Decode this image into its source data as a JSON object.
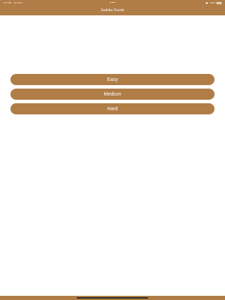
{
  "status_bar": {
    "time": "1:57 PM",
    "date": "Tue Oct 3",
    "battery": "100%"
  },
  "nav": {
    "title": "Sudoku Puzzle"
  },
  "menu": {
    "items": [
      {
        "label": "Easy"
      },
      {
        "label": "Medium"
      },
      {
        "label": "Hard"
      }
    ]
  },
  "theme": {
    "accent": "#b07d46",
    "background": "#ffffff",
    "text_on_accent": "#ffffff"
  }
}
